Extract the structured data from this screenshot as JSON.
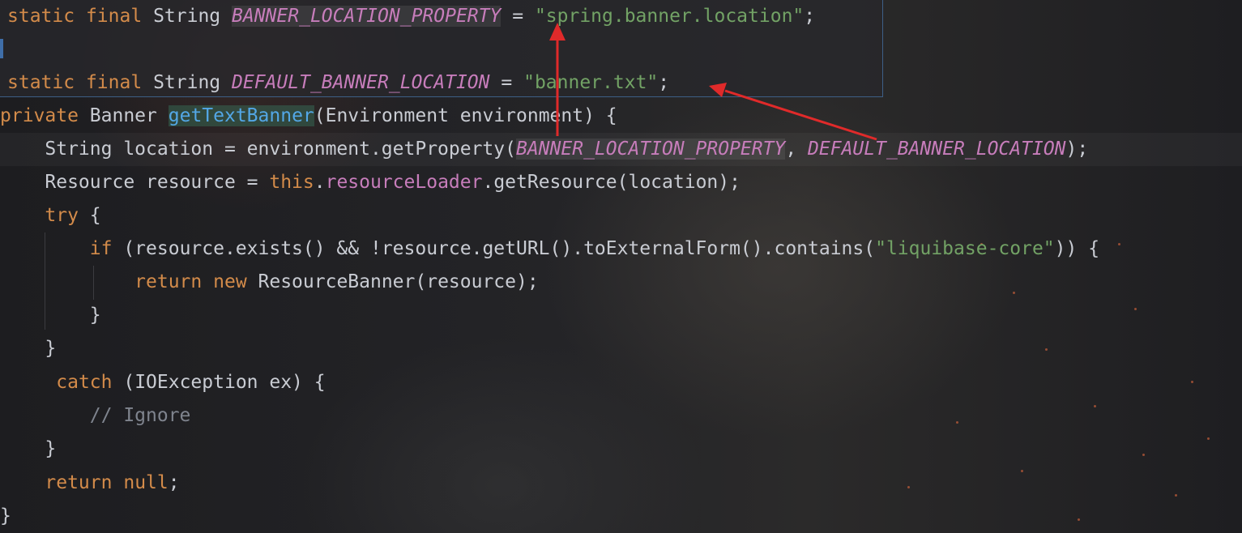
{
  "popup": {
    "line1": {
      "kw1": "static",
      "kw2": "final",
      "type": "String",
      "name": "BANNER_LOCATION_PROPERTY",
      "eq": "=",
      "value": "\"spring.banner.location\"",
      "semi": ";"
    },
    "line2": {
      "kw1": "static",
      "kw2": "final",
      "type": "String",
      "name": "DEFAULT_BANNER_LOCATION",
      "eq": "=",
      "value": "\"banner.txt\"",
      "semi": ";"
    }
  },
  "code": {
    "l1": {
      "kw": "private",
      "type": "Banner",
      "method": "getTextBanner",
      "rest": "(Environment environment) {"
    },
    "l2": {
      "pre": "String location = environment.getProperty(",
      "arg1": "BANNER_LOCATION_PROPERTY",
      "sep": ", ",
      "arg2": "DEFAULT_BANNER_LOCATION",
      "post": ");"
    },
    "l3": {
      "pre": "Resource resource = ",
      "kw": "this",
      "dot": ".",
      "field": "resourceLoader",
      "post": ".getResource(location);"
    },
    "l4": {
      "kw": "try",
      "post": " {"
    },
    "l5": {
      "kw": "if",
      "pre": " (resource.exists() && !resource.getURL().toExternalForm().contains(",
      "str": "\"liquibase-core\"",
      "post": ")) {"
    },
    "l6": {
      "kw1": "return",
      "kw2": "new",
      "post": " ResourceBanner(resource);"
    },
    "l7": {
      "text": "}"
    },
    "l8": {
      "text": "}"
    },
    "l9": {
      "kw": "catch",
      "post": " (IOException ex) {"
    },
    "l10": {
      "comment": "// Ignore"
    },
    "l11": {
      "text": "}"
    },
    "l12": {
      "kw1": "return",
      "kw2": "null",
      "post": ";"
    },
    "l13": {
      "text": "}"
    }
  },
  "colors": {
    "keyword": "#d38b4a",
    "string": "#72a265",
    "constant": "#c77dbb",
    "method_highlight": "#53a7e6",
    "comment": "#7f848e",
    "annotation_arrow": "#e02a2a"
  }
}
